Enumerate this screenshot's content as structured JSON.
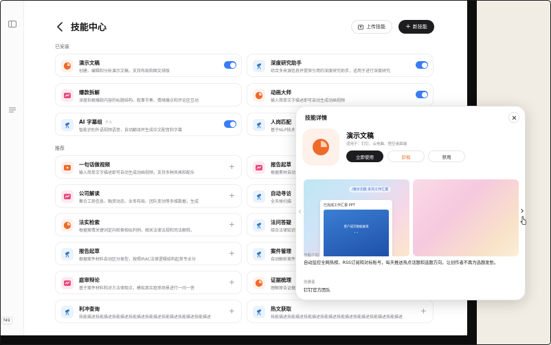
{
  "header": {
    "title": "技能中心",
    "upload_label": "上传技能",
    "new_label": "新技能",
    "new_icon": "plus-icon",
    "upload_icon": "upload-icon"
  },
  "rail": {
    "badge": "f49"
  },
  "installed": {
    "label": "已安装",
    "items": [
      {
        "name": "演示文稿",
        "tag": "",
        "desc": "创建、编辑和分析演示文稿，支持布局和图文排版",
        "icon": "doc-pie-icon",
        "enabled": true
      },
      {
        "name": "深度研究助手",
        "tag": "",
        "desc": "综合多来源信息并提供引用的深度研究助手，适用于进行深度研究",
        "icon": "telescope-icon",
        "enabled": true
      },
      {
        "name": "爆款拆解",
        "tag": "",
        "desc": "深度拆解爆款内容的标题结构、叙事节奏、情绪爆点和评论区互动",
        "icon": "hot-icon",
        "enabled": false
      },
      {
        "name": "动画大师",
        "tag": "",
        "desc": "输入简单文字描述即可自动生成动画视频",
        "icon": "doc-pie-icon",
        "enabled": true
      },
      {
        "name": "AI 字幕组",
        "tag": "个人",
        "desc": "智能识别外语视频语音，自动翻译并生成中文配音和字幕",
        "icon": "telescope-icon",
        "enabled": true
      },
      {
        "name": "人岗匹配",
        "tag": "",
        "desc": "基于NLP技术的人岗匹配",
        "icon": "telescope-icon",
        "enabled": false
      }
    ]
  },
  "recommended": {
    "label": "推荐",
    "items": [
      {
        "name": "一句话做视频",
        "desc": "输入简单文字描述即可自动生成动画视频，支持多种风格和配乐",
        "icon": "video-icon"
      },
      {
        "name": "报告起草",
        "desc": "根据素材自动起草报告",
        "icon": "hot-icon"
      },
      {
        "name": "公司解读",
        "desc": "聚合工商信息、融资动态、业务布局、团队变动等多维数据，生成",
        "icon": "hot-icon"
      },
      {
        "name": "自动寻访",
        "desc": "全天候扫描",
        "icon": "telescope-icon"
      },
      {
        "name": "法实检索",
        "desc": "根据案情关键词定向检索相似判例、相关法律法规和司法解释，",
        "icon": "doc-pie-icon"
      },
      {
        "name": "法问答疑",
        "desc": "结合法律知识",
        "icon": "telescope-icon"
      },
      {
        "name": "报告起草",
        "desc": "根据案件材料自动区分类型，按照IRAC法律逻辑结构起草专业分",
        "icon": "telescope-icon"
      },
      {
        "name": "案件管理",
        "desc": "自动解析案件",
        "icon": "telescope-icon"
      },
      {
        "name": "庭审辩论",
        "desc": "基于案件材料和对方法律观点，模拟真实庭审场景进行一问一答",
        "icon": "hot-icon"
      },
      {
        "name": "证据梳理",
        "desc": "理解原告证据",
        "icon": "doc-pie-icon"
      },
      {
        "name": "利冲查询",
        "desc": "技能描述技能描述技能描述技能描述技能描述技能描述技能描述技能描述",
        "icon": "telescope-icon"
      },
      {
        "name": "热文获取",
        "desc": "技能描述技能描述技能描述技能描述技能描述技能描述技能描述技能描述",
        "icon": "telescope-icon"
      }
    ]
  },
  "dialog": {
    "title": "技能详情",
    "name": "演示文稿",
    "apps": "适用于：钉钉、云电脑、悟空桌面端",
    "use_label": "立即使用",
    "unload_label": "卸载",
    "disable_label": "禁用",
    "shot_tag": "/演示文稿 本月工作汇报",
    "shot_doc_title": "已完成工作汇报 PPT",
    "shot_blue_text": "客户成交数据展现",
    "shot_blue_sub": "• •",
    "intro_label": "技能介绍",
    "intro": "自动监控全网热榜、RSS订阅和对标账号，每天推送热点话题和选题方向，让创作者不再为选题发愁。",
    "creator_label": "创建者",
    "creator": "钉钉官方团队",
    "close_icon": "close-icon",
    "prev_icon": "chevron-left-icon",
    "next_icon": "chevron-right-icon"
  },
  "colors": {
    "accent": "#3a7bf6",
    "dark_button": "#1d1d1f",
    "unload": "#e87a3c",
    "orange_icon": "#ee6a2b",
    "pink_icon": "#e94a7a",
    "blue_icon": "#2a72c7"
  }
}
